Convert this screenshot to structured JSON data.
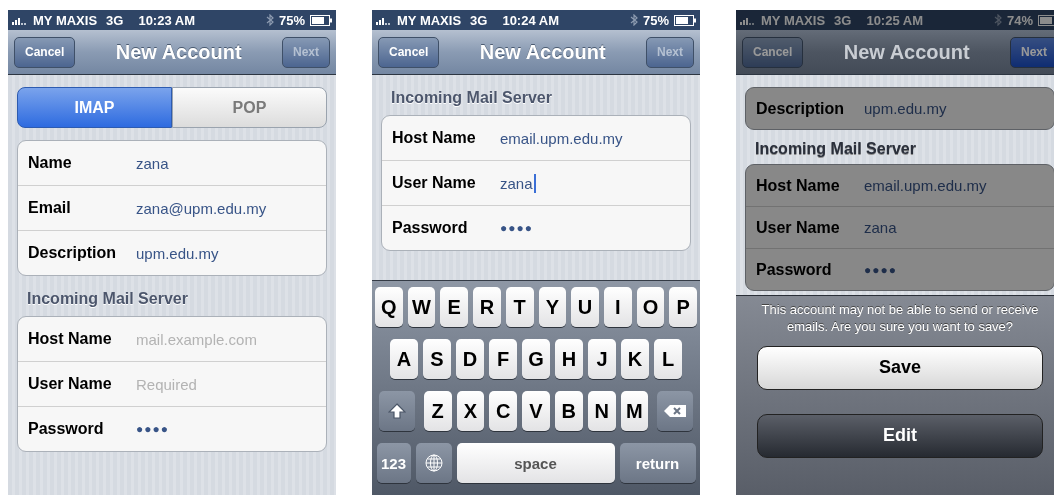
{
  "screens": [
    {
      "status_bar": {
        "carrier": "MY MAXIS",
        "network": "3G",
        "time": "10:23 AM",
        "battery": "75%"
      },
      "nav": {
        "cancel": "Cancel",
        "title": "New Account",
        "next": "Next",
        "next_disabled": true
      },
      "dimmed": false,
      "segments": [
        {
          "label": "IMAP",
          "selected": true
        },
        {
          "label": "POP",
          "selected": false
        }
      ],
      "groups": [
        {
          "fields": [
            {
              "label": "Name",
              "value": "zana",
              "kind": "text",
              "focused": false
            },
            {
              "label": "Email",
              "value": "zana@upm.edu.my",
              "kind": "text",
              "focused": false
            },
            {
              "label": "Description",
              "value": "upm.edu.my",
              "kind": "text",
              "focused": false
            }
          ]
        },
        {
          "heading": "Incoming Mail Server",
          "fields": [
            {
              "label": "Host Name",
              "placeholder": "mail.example.com",
              "kind": "text",
              "focused": false
            },
            {
              "label": "User Name",
              "placeholder": "Required",
              "kind": "text",
              "focused": false
            },
            {
              "label": "Password",
              "value": "●●●●",
              "kind": "password",
              "focused": false
            }
          ]
        }
      ]
    },
    {
      "status_bar": {
        "carrier": "MY MAXIS",
        "network": "3G",
        "time": "10:24 AM",
        "battery": "75%"
      },
      "nav": {
        "cancel": "Cancel",
        "title": "New Account",
        "next": "Next",
        "next_disabled": true
      },
      "dimmed": false,
      "groups": [
        {
          "heading": "Incoming Mail Server",
          "fields": [
            {
              "label": "Host Name",
              "value": "email.upm.edu.my",
              "kind": "text",
              "focused": false
            },
            {
              "label": "User Name",
              "value": "zana",
              "kind": "text",
              "focused": true
            },
            {
              "label": "Password",
              "value": "●●●●",
              "kind": "password",
              "focused": false
            }
          ]
        }
      ],
      "keyboard": {
        "bottom_row": {
          "mode": "123",
          "space": "space",
          "return": "return"
        },
        "rows": [
          [
            {
              "kind": "letter",
              "label": "Q"
            },
            {
              "kind": "letter",
              "label": "W"
            },
            {
              "kind": "letter",
              "label": "E"
            },
            {
              "kind": "letter",
              "label": "R"
            },
            {
              "kind": "letter",
              "label": "T"
            },
            {
              "kind": "letter",
              "label": "Y"
            },
            {
              "kind": "letter",
              "label": "U"
            },
            {
              "kind": "letter",
              "label": "I"
            },
            {
              "kind": "letter",
              "label": "O"
            },
            {
              "kind": "letter",
              "label": "P"
            }
          ],
          [
            {
              "kind": "letter",
              "label": "A"
            },
            {
              "kind": "letter",
              "label": "S"
            },
            {
              "kind": "letter",
              "label": "D"
            },
            {
              "kind": "letter",
              "label": "F"
            },
            {
              "kind": "letter",
              "label": "G"
            },
            {
              "kind": "letter",
              "label": "H"
            },
            {
              "kind": "letter",
              "label": "J"
            },
            {
              "kind": "letter",
              "label": "K"
            },
            {
              "kind": "letter",
              "label": "L"
            }
          ],
          [
            {
              "kind": "shift"
            },
            {
              "kind": "letter",
              "label": "Z"
            },
            {
              "kind": "letter",
              "label": "X"
            },
            {
              "kind": "letter",
              "label": "C"
            },
            {
              "kind": "letter",
              "label": "V"
            },
            {
              "kind": "letter",
              "label": "B"
            },
            {
              "kind": "letter",
              "label": "N"
            },
            {
              "kind": "letter",
              "label": "M"
            },
            {
              "kind": "delete"
            }
          ]
        ]
      }
    },
    {
      "status_bar": {
        "carrier": "MY MAXIS",
        "network": "3G",
        "time": "10:25 AM",
        "battery": "74%"
      },
      "nav": {
        "cancel": "Cancel",
        "title": "New Account",
        "next": "Next",
        "next_disabled": false
      },
      "dimmed": true,
      "groups": [
        {
          "fields": [
            {
              "label": "Description",
              "value": "upm.edu.my",
              "kind": "text",
              "focused": false
            }
          ]
        },
        {
          "heading": "Incoming Mail Server",
          "fields": [
            {
              "label": "Host Name",
              "value": "email.upm.edu.my",
              "kind": "text",
              "focused": false
            },
            {
              "label": "User Name",
              "value": "zana",
              "kind": "text",
              "focused": false
            },
            {
              "label": "Password",
              "value": "●●●●",
              "kind": "password",
              "focused": false
            }
          ]
        }
      ],
      "action_sheet": {
        "message": "This account may not be able to send or receive emails. Are you sure you want to save?",
        "buttons": [
          {
            "label": "Save",
            "kind": "default"
          },
          {
            "label": "Edit",
            "kind": "cancel"
          }
        ]
      }
    }
  ]
}
